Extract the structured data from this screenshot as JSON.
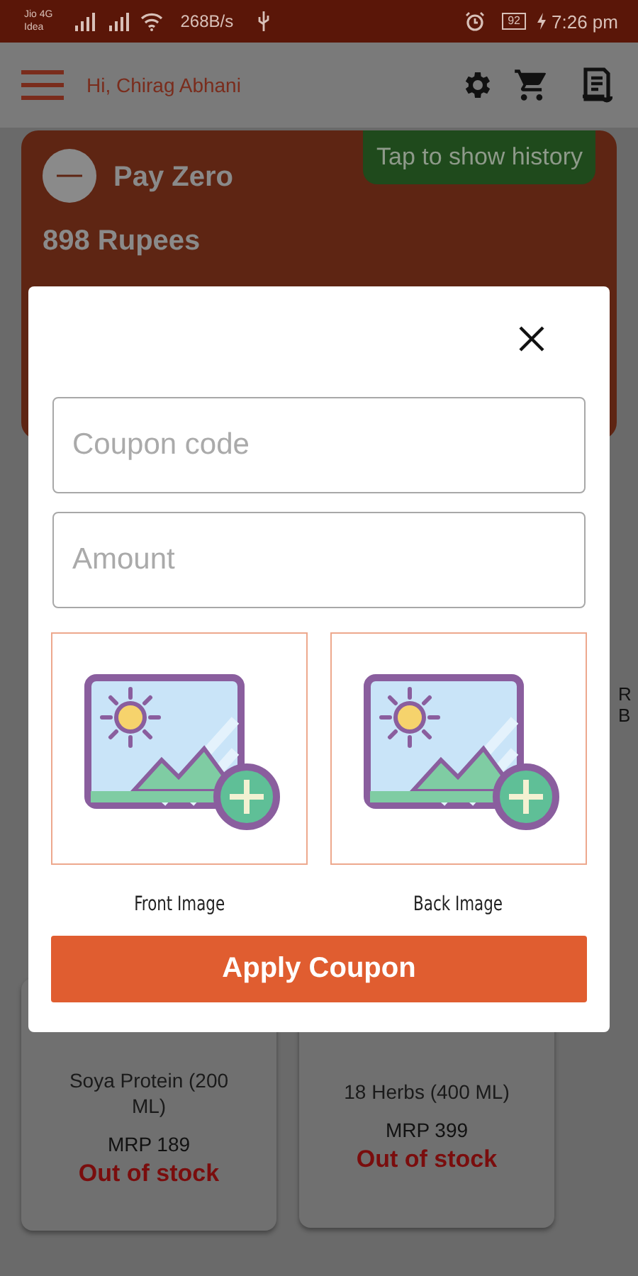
{
  "status_bar": {
    "carrier_1": "Jio 4G",
    "carrier_2": "Idea",
    "speed": "268B/s",
    "battery": "92",
    "time": "7:26 pm"
  },
  "header": {
    "greeting": "Hi, Chirag Abhani"
  },
  "wallet_card": {
    "name": "Pay Zero",
    "balance": "898 Rupees",
    "history_button": "Tap to show history"
  },
  "side_fragments": [
    "R",
    "B"
  ],
  "products": [
    {
      "name": "Soya Protein (200 ML)",
      "price": "MRP 189",
      "stock": "Out of stock"
    },
    {
      "name": "18 Herbs (400 ML)",
      "price": "MRP 399",
      "stock": "Out of stock"
    }
  ],
  "dialog": {
    "fields": [
      {
        "placeholder": "Coupon code"
      },
      {
        "placeholder": "Amount"
      }
    ],
    "uploads": [
      {
        "label": "Front Image"
      },
      {
        "label": "Back Image"
      }
    ],
    "button": "Apply Coupon"
  }
}
